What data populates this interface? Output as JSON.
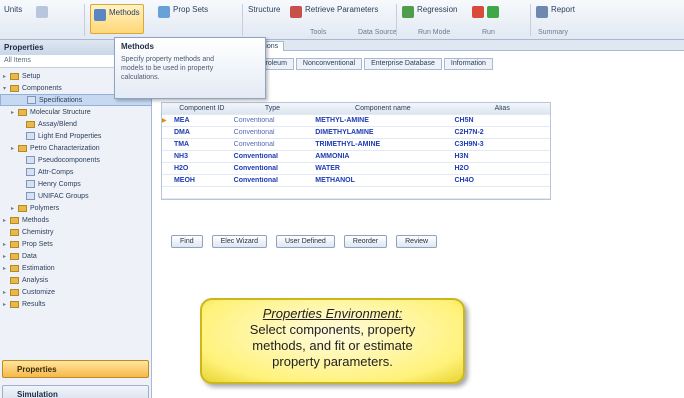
{
  "ribbon": {
    "buttons": [
      {
        "label": "Methods",
        "color": "#5b86c4"
      },
      {
        "label": "Prop Sets",
        "color": "#6aa0d8"
      },
      {
        "label": "Structure",
        "color": "#9aa6b6"
      },
      {
        "label": "Retrieve Parameters",
        "color": "#c8504a"
      },
      {
        "label": "Regression",
        "color": "#4f9d4a"
      },
      {
        "label": "Report",
        "color": "#6f88b0"
      }
    ],
    "groups": [
      "Units",
      "Tools",
      "Data Source",
      "Run Mode",
      "Run",
      "Summary"
    ]
  },
  "tooltip": {
    "title": "Methods",
    "text": "Specify property methods and models to be used in property calculations."
  },
  "sidebar": {
    "title": "Properties",
    "filter": "All Items",
    "tree": [
      {
        "label": "Setup",
        "indent": 0,
        "kind": "folder",
        "toggle": "▸"
      },
      {
        "label": "Components",
        "indent": 0,
        "kind": "folder",
        "toggle": "▾"
      },
      {
        "label": "Specifications",
        "indent": 2,
        "kind": "doc",
        "toggle": "",
        "selected": true
      },
      {
        "label": "Molecular Structure",
        "indent": 1,
        "kind": "folder",
        "toggle": "▸"
      },
      {
        "label": "Assay/Blend",
        "indent": 2,
        "kind": "folder",
        "toggle": ""
      },
      {
        "label": "Light End Properties",
        "indent": 2,
        "kind": "doc",
        "toggle": ""
      },
      {
        "label": "Petro Characterization",
        "indent": 1,
        "kind": "folder",
        "toggle": "▸"
      },
      {
        "label": "Pseudocomponents",
        "indent": 2,
        "kind": "doc",
        "toggle": ""
      },
      {
        "label": "Attr-Comps",
        "indent": 2,
        "kind": "doc",
        "toggle": ""
      },
      {
        "label": "Henry Comps",
        "indent": 2,
        "kind": "doc",
        "toggle": ""
      },
      {
        "label": "UNIFAC Groups",
        "indent": 2,
        "kind": "doc",
        "toggle": ""
      },
      {
        "label": "Polymers",
        "indent": 1,
        "kind": "folder",
        "toggle": "▸"
      },
      {
        "label": "Methods",
        "indent": 0,
        "kind": "folder",
        "toggle": "▸"
      },
      {
        "label": "Chemistry",
        "indent": 0,
        "kind": "folder",
        "toggle": ""
      },
      {
        "label": "Prop Sets",
        "indent": 0,
        "kind": "folder",
        "toggle": "▸"
      },
      {
        "label": "Data",
        "indent": 0,
        "kind": "folder",
        "toggle": "▸"
      },
      {
        "label": "Estimation",
        "indent": 0,
        "kind": "folder",
        "toggle": "▸"
      },
      {
        "label": "Analysis",
        "indent": 0,
        "kind": "folder",
        "toggle": ""
      },
      {
        "label": "Customize",
        "indent": 0,
        "kind": "folder",
        "toggle": "▸"
      },
      {
        "label": "Results",
        "indent": 0,
        "kind": "folder",
        "toggle": "▸"
      }
    ],
    "nav": {
      "properties": "Properties",
      "simulation": "Simulation"
    }
  },
  "content": {
    "doc_tab": "Components - Specifications",
    "subtabs": [
      "Selection",
      "Petroleum",
      "Nonconventional",
      "Enterprise Database",
      "Information"
    ],
    "table": {
      "headers": [
        "Component ID",
        "Type",
        "Component name",
        "Alias"
      ],
      "rows": [
        {
          "id": "MEA",
          "type": "Conventional",
          "name": "METHYL-AMINE",
          "alias": "CH5N",
          "bold": false
        },
        {
          "id": "DMA",
          "type": "Conventional",
          "name": "DIMETHYLAMINE",
          "alias": "C2H7N-2",
          "bold": false
        },
        {
          "id": "TMA",
          "type": "Conventional",
          "name": "TRIMETHYL-AMINE",
          "alias": "C3H9N-3",
          "bold": false
        },
        {
          "id": "NH3",
          "type": "Conventional",
          "name": "AMMONIA",
          "alias": "H3N",
          "bold": true
        },
        {
          "id": "H2O",
          "type": "Conventional",
          "name": "WATER",
          "alias": "H2O",
          "bold": true
        },
        {
          "id": "MEOH",
          "type": "Conventional",
          "name": "METHANOL",
          "alias": "CH4O",
          "bold": true
        }
      ]
    },
    "buttons": [
      "Find",
      "Elec Wizard",
      "User Defined",
      "Reorder",
      "Review"
    ]
  },
  "callout": {
    "title": "Properties Environment:",
    "lines": [
      "Select components, property",
      "methods, and fit or estimate",
      "property parameters."
    ]
  }
}
